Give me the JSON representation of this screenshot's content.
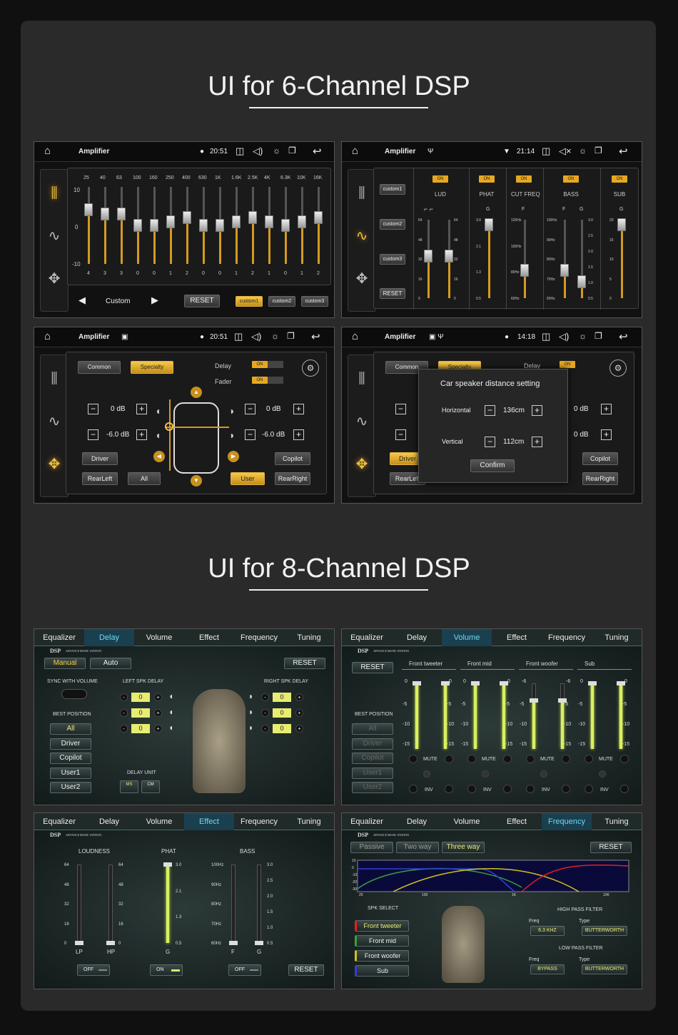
{
  "headings": {
    "six": "UI for 6-Channel DSP",
    "eight": "UI for 8-Channel DSP"
  },
  "amp": {
    "title": "Amplifier",
    "time1": "20:51",
    "time2": "21:14",
    "time3": "20:51",
    "time4": "14:18"
  },
  "eq": {
    "freqs": [
      "25",
      "40",
      "63",
      "100",
      "160",
      "250",
      "400",
      "630",
      "1K",
      "1.6K",
      "2.5K",
      "4K",
      "6.3K",
      "10K",
      "16K"
    ],
    "values": [
      4,
      3,
      3,
      0,
      0,
      1,
      2,
      0,
      0,
      1,
      2,
      1,
      0,
      1,
      2
    ],
    "ymax": "10",
    "ymid": "0",
    "ymin": "-10",
    "preset": "Custom",
    "reset": "RESET",
    "custom1": "custom1",
    "custom2": "custom2",
    "custom3": "custom3"
  },
  "s2": {
    "c1": "custom1",
    "c2": "custom2",
    "c3": "custom3",
    "reset": "RESET",
    "on": "ON",
    "cols": [
      "LUD",
      "PHAT",
      "CUT FREQ",
      "BASS",
      "SUB"
    ],
    "lud_scale": [
      "64",
      "48",
      "32",
      "16",
      "0"
    ],
    "phat_scale": [
      "3.0",
      "2.1",
      "1.3",
      "0.5"
    ],
    "cut_scale": [
      "120Hz",
      "100Hz",
      "80Hz",
      "60Hz"
    ],
    "bass_scale": [
      "100Hz",
      "90Hz",
      "80Hz",
      "70Hz",
      "60Hz"
    ],
    "bass_g": [
      "3.0",
      "2.5",
      "2.0",
      "1.5",
      "1.0",
      "0.5"
    ],
    "sub_scale": [
      "20",
      "15",
      "10",
      "5",
      "0"
    ],
    "g": "G",
    "f": "F"
  },
  "s3": {
    "common": "Common",
    "specialty": "Specialty",
    "delay": "Delay",
    "fader": "Fader",
    "on": "ON",
    "db0": "0 dB",
    "db6": "-6.0 dB",
    "driver": "Driver",
    "copilot": "Copilot",
    "rearleft": "RearLeft",
    "all": "All",
    "user": "User",
    "rearright": "RearRight"
  },
  "s4": {
    "dialog_title": "Car speaker distance setting",
    "horizontal": "Horizontal",
    "hval": "136cm",
    "vertical": "Vertical",
    "vval": "112cm",
    "confirm": "Confirm",
    "db0": "0 dB",
    "driver": "Driver",
    "copilot": "Copilot",
    "rearleft": "RearLeft",
    "rearright": "RearRight",
    "common": "Common",
    "specialty": "Specialty",
    "delay": "Delay",
    "on": "ON"
  },
  "dsptabs": [
    "Equalizer",
    "Delay",
    "Volume",
    "Effect",
    "Frequency",
    "Tuning"
  ],
  "dsp": {
    "logo": "DSP",
    "sub": "ADVANCE MUSIC STATION"
  },
  "d1": {
    "manual": "Manual",
    "auto": "Auto",
    "reset": "RESET",
    "sync": "SYNC WITH VOLUME",
    "left": "LEFT SPK DELAY",
    "right": "RIGHT SPK DELAY",
    "best": "BEST POSITION",
    "positions": [
      "All",
      "Driver",
      "Copilot",
      "User1",
      "User2"
    ],
    "unit": "DELAY UNIT",
    "ms": "MS",
    "cm": "CM",
    "zero": "0"
  },
  "d2": {
    "reset": "RESET",
    "best": "BEST POSITION",
    "positions": [
      "All",
      "Driver",
      "Copilot",
      "User1",
      "User2"
    ],
    "groups": [
      "Front tweeter",
      "Front mid",
      "Front woofer",
      "Sub"
    ],
    "mute": "MUTE",
    "inv": "INV",
    "top": [
      "0",
      "0",
      "0",
      "0",
      "-6",
      "-6",
      "0",
      "0"
    ],
    "scale": [
      "-5",
      "-10",
      "-15"
    ]
  },
  "d3": {
    "loud": "LOUDNESS",
    "phat": "PHAT",
    "bass": "BASS",
    "l_scale": [
      "64",
      "48",
      "32",
      "16",
      "0"
    ],
    "p_scale": [
      "3.0",
      "2.1",
      "1.3",
      "0.5"
    ],
    "b_freq": [
      "100Hz",
      "90Hz",
      "80Hz",
      "70Hz",
      "60Hz"
    ],
    "b_g": [
      "3.0",
      "2.5",
      "2.0",
      "1.5",
      "1.0",
      "0.5"
    ],
    "lp": "LP",
    "hp": "HP",
    "g": "G",
    "f": "F",
    "off": "OFF",
    "on": "ON",
    "reset": "RESET"
  },
  "d4": {
    "passive": "Passive",
    "twoway": "Two way",
    "threeway": "Three way",
    "reset": "RESET",
    "yticks": [
      "10",
      "0",
      "-10",
      "-20",
      "-30"
    ],
    "xticks": [
      "20",
      "100",
      "1K",
      "10K"
    ],
    "spk": "SPK SELECT",
    "spks": [
      "Front tweeter",
      "Front mid",
      "Front woofer",
      "Sub"
    ],
    "hpf": "HIGH PASS FILTER",
    "lpf": "LOW PASS FILTER",
    "freq": "Freq",
    "type": "Type",
    "hf": "6.3 KHZ",
    "ht": "BUTTERWORTH",
    "lf": "BYPASS",
    "lt": "BUTTERWORTH"
  },
  "colors": {
    "gold": "#e6a820",
    "dsp_yellow": "#d8f060",
    "dsp_cyan": "#6fd8f0"
  }
}
